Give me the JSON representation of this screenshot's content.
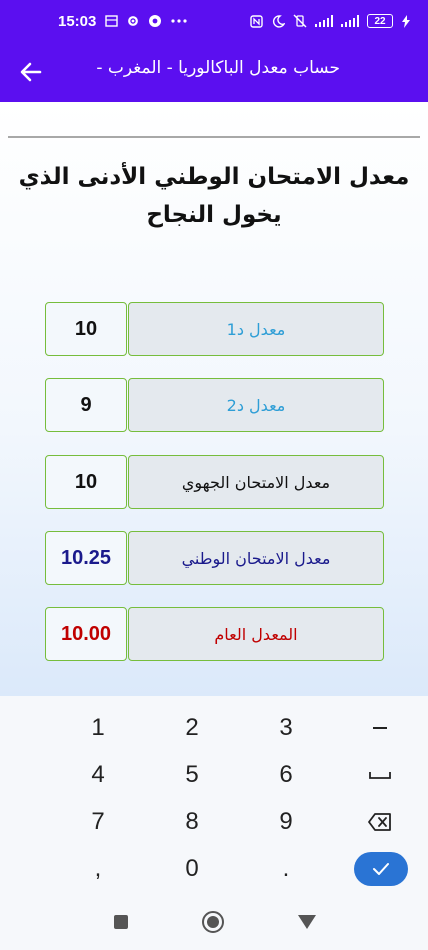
{
  "status_bar": {
    "time": "15:03",
    "battery": "22",
    "icons": [
      "gallery-icon",
      "gear-icon",
      "chrome-icon",
      "more-dots-icon",
      "nfc-icon",
      "moon-icon",
      "vibrate-off-icon",
      "signal-icon",
      "signal-icon",
      "battery-icon",
      "charging-icon"
    ]
  },
  "app_bar": {
    "title": "حساب معدل الباكالوريا - المغرب -"
  },
  "main": {
    "heading": "معدل الامتحان الوطني الأدنى الذي يخول النجاح",
    "rows": [
      {
        "label": "معدل  د1",
        "value": "10",
        "label_color": "#2e9ed6",
        "value_color": "#111111"
      },
      {
        "label": "معدل  د2",
        "value": "9",
        "label_color": "#2e9ed6",
        "value_color": "#111111"
      },
      {
        "label": "معدل الامتحان الجهوي",
        "value": "10",
        "label_color": "#111111",
        "value_color": "#111111"
      },
      {
        "label": "معدل الامتحان الوطني",
        "value": "10.25",
        "label_color": "#1a1a8c",
        "value_color": "#1a1a8c"
      },
      {
        "label": "المعدل العام",
        "value": "10.00",
        "label_color": "#c00000",
        "value_color": "#c00000"
      }
    ]
  },
  "keyboard": {
    "keys": [
      [
        "1",
        "2",
        "3",
        "–"
      ],
      [
        "4",
        "5",
        "6",
        "␣"
      ],
      [
        "7",
        "8",
        "9",
        "⌫"
      ],
      [
        ",",
        "0",
        ".",
        "✓"
      ]
    ]
  },
  "colors": {
    "primary": "#5b0ff0",
    "border_green": "#76bd3c",
    "enter_blue": "#2a74d4"
  }
}
